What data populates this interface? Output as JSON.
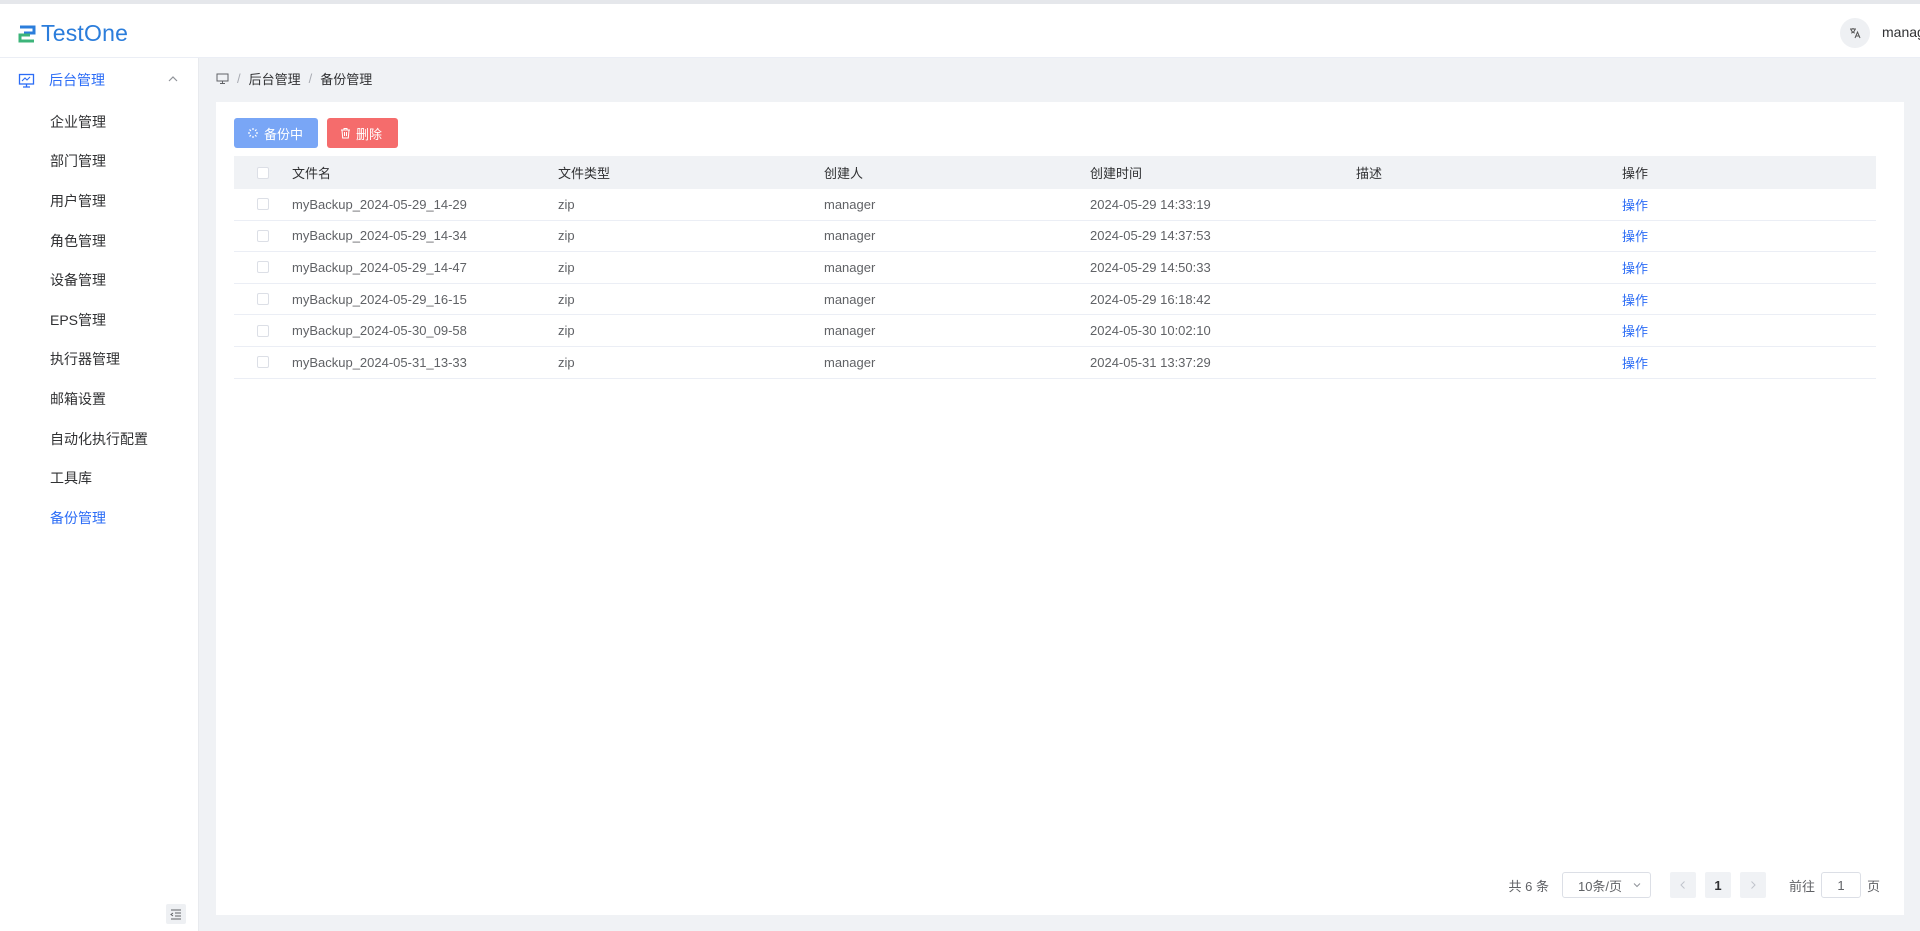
{
  "app": {
    "logo_text": "TestOne",
    "user_name": "manager",
    "lang_icon": "translate-icon"
  },
  "sidebar": {
    "parent": {
      "label": "后台管理",
      "icon": "monitor-icon",
      "expanded": true
    },
    "items": [
      {
        "label": "企业管理"
      },
      {
        "label": "部门管理"
      },
      {
        "label": "用户管理"
      },
      {
        "label": "角色管理"
      },
      {
        "label": "设备管理"
      },
      {
        "label": "EPS管理"
      },
      {
        "label": "执行器管理"
      },
      {
        "label": "邮箱设置"
      },
      {
        "label": "自动化执行配置"
      },
      {
        "label": "工具库"
      },
      {
        "label": "备份管理",
        "active": true
      }
    ]
  },
  "breadcrumb": {
    "items": [
      "后台管理",
      "备份管理"
    ]
  },
  "toolbar": {
    "backup_label": "备份中",
    "delete_label": "删除"
  },
  "table": {
    "columns": [
      "文件名",
      "文件类型",
      "创建人",
      "创建时间",
      "描述",
      "操作"
    ],
    "rows": [
      {
        "name": "myBackup_2024-05-29_14-29",
        "type": "zip",
        "creator": "manager",
        "time": "2024-05-29 14:33:19",
        "desc": "",
        "op": "操作"
      },
      {
        "name": "myBackup_2024-05-29_14-34",
        "type": "zip",
        "creator": "manager",
        "time": "2024-05-29 14:37:53",
        "desc": "",
        "op": "操作"
      },
      {
        "name": "myBackup_2024-05-29_14-47",
        "type": "zip",
        "creator": "manager",
        "time": "2024-05-29 14:50:33",
        "desc": "",
        "op": "操作"
      },
      {
        "name": "myBackup_2024-05-29_16-15",
        "type": "zip",
        "creator": "manager",
        "time": "2024-05-29 16:18:42",
        "desc": "",
        "op": "操作"
      },
      {
        "name": "myBackup_2024-05-30_09-58",
        "type": "zip",
        "creator": "manager",
        "time": "2024-05-30 10:02:10",
        "desc": "",
        "op": "操作"
      },
      {
        "name": "myBackup_2024-05-31_13-33",
        "type": "zip",
        "creator": "manager",
        "time": "2024-05-31 13:37:29",
        "desc": "",
        "op": "操作"
      }
    ]
  },
  "pagination": {
    "total_text": "共 6 条",
    "page_size": "10条/页",
    "current_page": "1",
    "goto_label": "前往",
    "goto_value": "1",
    "page_suffix": "页"
  },
  "colors": {
    "primary": "#2b6cf6",
    "logo": "#2b7ddb",
    "danger": "#f56c6c",
    "backup_btn": "#79a6f6"
  }
}
